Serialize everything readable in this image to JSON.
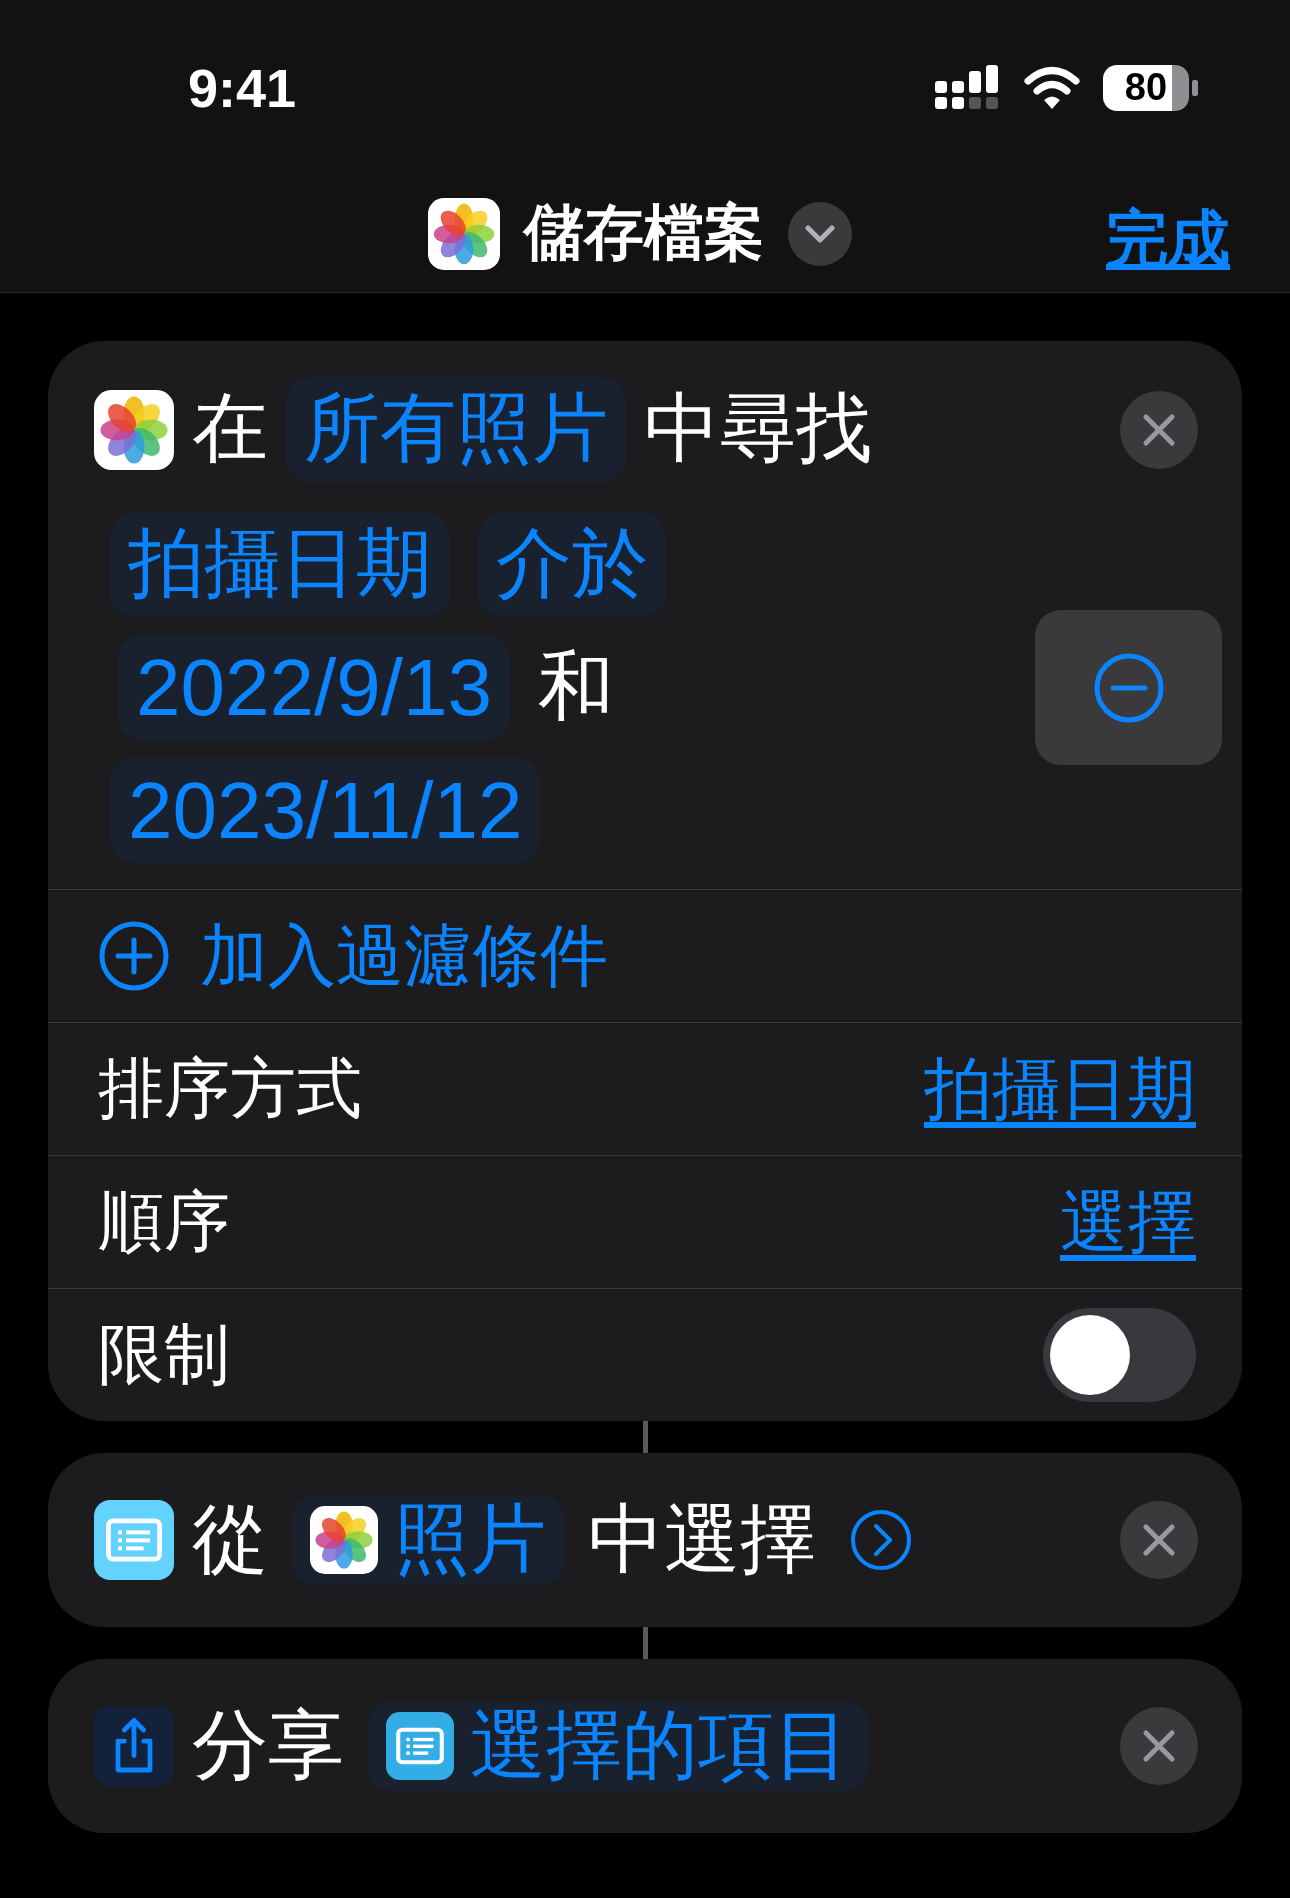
{
  "status_bar": {
    "time": "9:41",
    "battery": "80"
  },
  "nav": {
    "title": "儲存檔案",
    "done": "完成"
  },
  "actions": [
    {
      "kind": "find",
      "prefix": "在",
      "source": "所有照片",
      "suffix": "中尋找",
      "filter": {
        "property": "拍攝日期",
        "operator": "介於",
        "value_1": "2022/9/13",
        "conjunction": "和",
        "value_2": "2023/11/12"
      },
      "add_filter": "加入過濾條件",
      "options": [
        {
          "kind": "value",
          "label": "排序方式",
          "value": "拍攝日期"
        },
        {
          "kind": "value",
          "label": "順序",
          "value": "選擇"
        },
        {
          "kind": "toggle",
          "label": "限制",
          "on": false
        }
      ]
    },
    {
      "kind": "choose",
      "prefix": "從",
      "token": "照片",
      "suffix": "中選擇"
    },
    {
      "kind": "share",
      "prefix": "分享",
      "token": "選擇的項目"
    }
  ]
}
